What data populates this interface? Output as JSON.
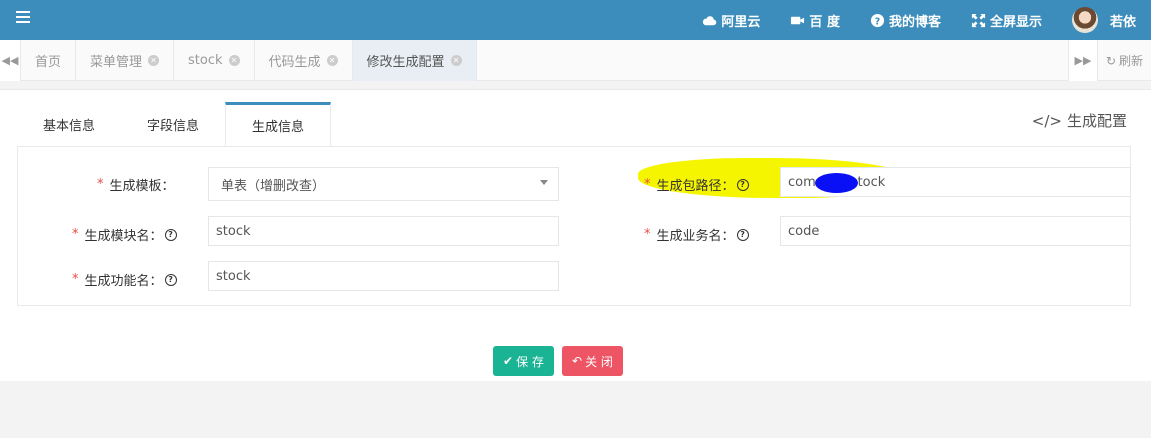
{
  "header": {
    "links": [
      {
        "label": "阿里云",
        "icon": "cloud-icon"
      },
      {
        "label": "百 度",
        "icon": "video-icon"
      },
      {
        "label": "我的博客",
        "icon": "question-circle-icon"
      },
      {
        "label": "全屏显示",
        "icon": "fullscreen-icon"
      }
    ],
    "user_name": "若依"
  },
  "tabs": [
    {
      "label": "首页",
      "closable": false
    },
    {
      "label": "菜单管理",
      "closable": true
    },
    {
      "label": "stock",
      "closable": true
    },
    {
      "label": "代码生成",
      "closable": true
    },
    {
      "label": "修改生成配置",
      "closable": true,
      "active": true
    }
  ],
  "refresh_label": "刷新",
  "form_tabs": [
    "基本信息",
    "字段信息",
    "生成信息"
  ],
  "config_title": "生成配置",
  "fields": {
    "template": {
      "label": "生成模板：",
      "value": "单表（增删改查）"
    },
    "package": {
      "label": "生成包路径：",
      "value": "com",
      "value_tail": "stock"
    },
    "module": {
      "label": "生成模块名：",
      "value": "stock"
    },
    "business": {
      "label": "生成业务名：",
      "value": "code"
    },
    "function": {
      "label": "生成功能名：",
      "value": "stock"
    }
  },
  "buttons": {
    "save": "保 存",
    "close": "关 闭"
  },
  "colors": {
    "navbar": "#3c8dbc",
    "save": "#1ab394",
    "close": "#ed5565",
    "required": "#e54d42"
  }
}
